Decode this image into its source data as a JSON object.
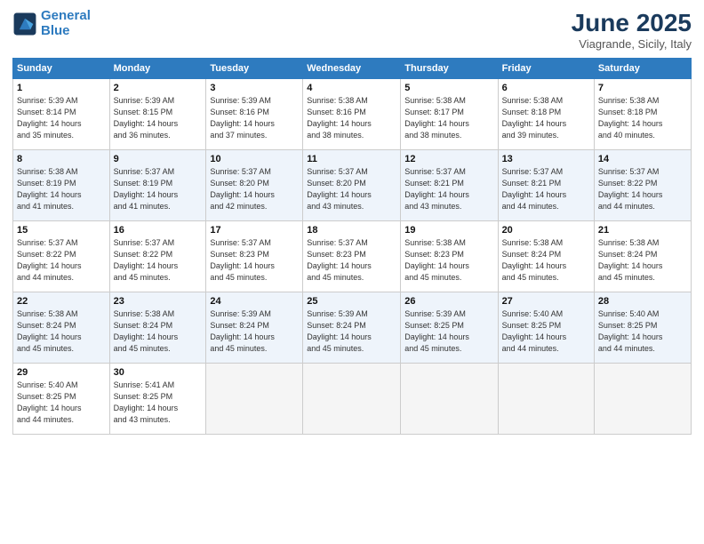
{
  "logo": {
    "line1": "General",
    "line2": "Blue"
  },
  "title": "June 2025",
  "subtitle": "Viagrande, Sicily, Italy",
  "headers": [
    "Sunday",
    "Monday",
    "Tuesday",
    "Wednesday",
    "Thursday",
    "Friday",
    "Saturday"
  ],
  "weeks": [
    [
      {
        "day": "1",
        "info": "Sunrise: 5:39 AM\nSunset: 8:14 PM\nDaylight: 14 hours\nand 35 minutes."
      },
      {
        "day": "2",
        "info": "Sunrise: 5:39 AM\nSunset: 8:15 PM\nDaylight: 14 hours\nand 36 minutes."
      },
      {
        "day": "3",
        "info": "Sunrise: 5:39 AM\nSunset: 8:16 PM\nDaylight: 14 hours\nand 37 minutes."
      },
      {
        "day": "4",
        "info": "Sunrise: 5:38 AM\nSunset: 8:16 PM\nDaylight: 14 hours\nand 38 minutes."
      },
      {
        "day": "5",
        "info": "Sunrise: 5:38 AM\nSunset: 8:17 PM\nDaylight: 14 hours\nand 38 minutes."
      },
      {
        "day": "6",
        "info": "Sunrise: 5:38 AM\nSunset: 8:18 PM\nDaylight: 14 hours\nand 39 minutes."
      },
      {
        "day": "7",
        "info": "Sunrise: 5:38 AM\nSunset: 8:18 PM\nDaylight: 14 hours\nand 40 minutes."
      }
    ],
    [
      {
        "day": "8",
        "info": "Sunrise: 5:38 AM\nSunset: 8:19 PM\nDaylight: 14 hours\nand 41 minutes."
      },
      {
        "day": "9",
        "info": "Sunrise: 5:37 AM\nSunset: 8:19 PM\nDaylight: 14 hours\nand 41 minutes."
      },
      {
        "day": "10",
        "info": "Sunrise: 5:37 AM\nSunset: 8:20 PM\nDaylight: 14 hours\nand 42 minutes."
      },
      {
        "day": "11",
        "info": "Sunrise: 5:37 AM\nSunset: 8:20 PM\nDaylight: 14 hours\nand 43 minutes."
      },
      {
        "day": "12",
        "info": "Sunrise: 5:37 AM\nSunset: 8:21 PM\nDaylight: 14 hours\nand 43 minutes."
      },
      {
        "day": "13",
        "info": "Sunrise: 5:37 AM\nSunset: 8:21 PM\nDaylight: 14 hours\nand 44 minutes."
      },
      {
        "day": "14",
        "info": "Sunrise: 5:37 AM\nSunset: 8:22 PM\nDaylight: 14 hours\nand 44 minutes."
      }
    ],
    [
      {
        "day": "15",
        "info": "Sunrise: 5:37 AM\nSunset: 8:22 PM\nDaylight: 14 hours\nand 44 minutes."
      },
      {
        "day": "16",
        "info": "Sunrise: 5:37 AM\nSunset: 8:22 PM\nDaylight: 14 hours\nand 45 minutes."
      },
      {
        "day": "17",
        "info": "Sunrise: 5:37 AM\nSunset: 8:23 PM\nDaylight: 14 hours\nand 45 minutes."
      },
      {
        "day": "18",
        "info": "Sunrise: 5:37 AM\nSunset: 8:23 PM\nDaylight: 14 hours\nand 45 minutes."
      },
      {
        "day": "19",
        "info": "Sunrise: 5:38 AM\nSunset: 8:23 PM\nDaylight: 14 hours\nand 45 minutes."
      },
      {
        "day": "20",
        "info": "Sunrise: 5:38 AM\nSunset: 8:24 PM\nDaylight: 14 hours\nand 45 minutes."
      },
      {
        "day": "21",
        "info": "Sunrise: 5:38 AM\nSunset: 8:24 PM\nDaylight: 14 hours\nand 45 minutes."
      }
    ],
    [
      {
        "day": "22",
        "info": "Sunrise: 5:38 AM\nSunset: 8:24 PM\nDaylight: 14 hours\nand 45 minutes."
      },
      {
        "day": "23",
        "info": "Sunrise: 5:38 AM\nSunset: 8:24 PM\nDaylight: 14 hours\nand 45 minutes."
      },
      {
        "day": "24",
        "info": "Sunrise: 5:39 AM\nSunset: 8:24 PM\nDaylight: 14 hours\nand 45 minutes."
      },
      {
        "day": "25",
        "info": "Sunrise: 5:39 AM\nSunset: 8:24 PM\nDaylight: 14 hours\nand 45 minutes."
      },
      {
        "day": "26",
        "info": "Sunrise: 5:39 AM\nSunset: 8:25 PM\nDaylight: 14 hours\nand 45 minutes."
      },
      {
        "day": "27",
        "info": "Sunrise: 5:40 AM\nSunset: 8:25 PM\nDaylight: 14 hours\nand 44 minutes."
      },
      {
        "day": "28",
        "info": "Sunrise: 5:40 AM\nSunset: 8:25 PM\nDaylight: 14 hours\nand 44 minutes."
      }
    ],
    [
      {
        "day": "29",
        "info": "Sunrise: 5:40 AM\nSunset: 8:25 PM\nDaylight: 14 hours\nand 44 minutes."
      },
      {
        "day": "30",
        "info": "Sunrise: 5:41 AM\nSunset: 8:25 PM\nDaylight: 14 hours\nand 43 minutes."
      },
      {
        "day": "",
        "info": ""
      },
      {
        "day": "",
        "info": ""
      },
      {
        "day": "",
        "info": ""
      },
      {
        "day": "",
        "info": ""
      },
      {
        "day": "",
        "info": ""
      }
    ]
  ]
}
